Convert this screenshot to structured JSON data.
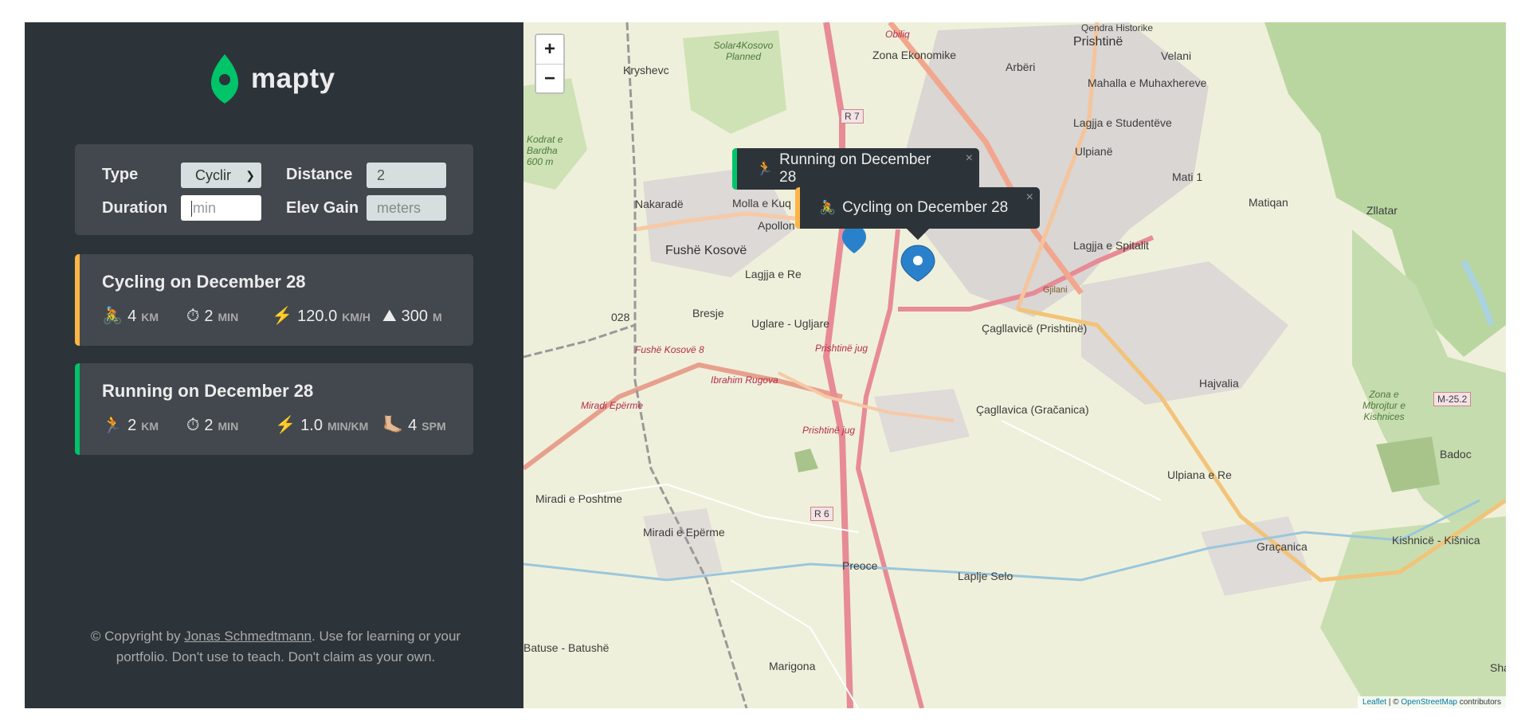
{
  "brand": {
    "name": "mapty",
    "accent": "#00c46a"
  },
  "form": {
    "type_label": "Type",
    "type_value": "Cyclir",
    "distance_label": "Distance",
    "distance_value": "2",
    "duration_label": "Duration",
    "duration_placeholder": "min",
    "elev_label": "Elev Gain",
    "elev_placeholder": "meters"
  },
  "workouts": [
    {
      "title": "Cycling on December 28",
      "accent": "#ffb545",
      "stats": [
        {
          "icon": "🚴",
          "value": "4",
          "unit": "km"
        },
        {
          "icon": "⏱",
          "value": "2",
          "unit": "min"
        },
        {
          "icon": "⚡️",
          "value": "120.0",
          "unit": "km/h"
        },
        {
          "icon": "⛰",
          "value": "300",
          "unit": "m"
        }
      ]
    },
    {
      "title": "Running on December 28",
      "accent": "#00c46a",
      "stats": [
        {
          "icon": "🏃",
          "value": "2",
          "unit": "km"
        },
        {
          "icon": "⏱",
          "value": "2",
          "unit": "min"
        },
        {
          "icon": "⚡️",
          "value": "1.0",
          "unit": "min/km"
        },
        {
          "icon": "🦶🏼",
          "value": "4",
          "unit": "spm"
        }
      ]
    }
  ],
  "footer": {
    "prefix": "© Copyright by ",
    "author": "Jonas Schmedtmann",
    "suffix": ". Use for learning or your portfolio. Don't use to teach. Don't claim as your own."
  },
  "map": {
    "zoom_in": "+",
    "zoom_out": "−",
    "popups": [
      {
        "icon": "🏃",
        "text": "Running on December 28",
        "accent": "#00c46a",
        "close": "×"
      },
      {
        "icon": "🚴",
        "text": "Cycling on December 28",
        "accent": "#ffb545",
        "close": "×"
      }
    ],
    "attribution": {
      "leaflet": "Leaflet",
      "sep": " | © ",
      "osm": "OpenStreetMap",
      "tail": " contributors"
    },
    "labels": {
      "prishtine": "Prishtinë",
      "velani": "Velani",
      "mahalla": "Mahalla e Muhaxhereve",
      "lagjja_studenteve": "Lagjja e Studentëve",
      "ulpiane": "Ulpianë",
      "mati": "Mati 1",
      "matiqan": "Matiqan",
      "zllatar": "Zllatar",
      "zona_ekonomike": "Zona Ekonomike",
      "arberi": "Arbëri",
      "kryshevc": "Kryshevc",
      "nakarade": "Nakaradë",
      "molla": "Molla e Kuq",
      "apollon": "Apollon",
      "fushe_kosove": "Fushë Kosovë",
      "lagjja_re": "Lagjja e Re",
      "lagjja_spitalit": "Lagjja e Spitalit",
      "bresje": "Bresje",
      "uglare": "Uglare - Ugljare",
      "caglavica_prishtine": "Çagllavicë (Prishtinë)",
      "caglavica_gracanica": "Çagllavica (Gračanica)",
      "hajvalia": "Hajvalia",
      "ulpiana_re": "Ulpiana e Re",
      "badoc": "Badoc",
      "gracanica": "Graçanica",
      "kishnice": "Kishnicë - Kišnica",
      "miradi_poshtme": "Miradi e Poshtme",
      "miradi_eperme": "Miradi e Epërme",
      "preoce": "Preoce",
      "laplje": "Laplje Selo",
      "batuse": "Batuse - Batushë",
      "marigona": "Marigona",
      "code028": "028",
      "r7": "R 7",
      "r6": "R 6",
      "m252": "M-25.2",
      "solar": "Solar4Kosovo Planned",
      "kodrat": "Kodrat e Bardha 600 m",
      "prishtine_jug": "Prishtinë jug",
      "fushe_kosove_8": "Fushë Kosovë 8",
      "miradi_eperme_rail": "Miradi Epërme",
      "gjilani": "Gjilani",
      "ibrahim_rugova": "Ibrahim Rugova",
      "zona_mbrojtur": "Zona e Mbrojtur e Kishnices",
      "obiliq": "Obiliq",
      "qendra": "Qendra Historike",
      "sha": "Sha"
    }
  }
}
